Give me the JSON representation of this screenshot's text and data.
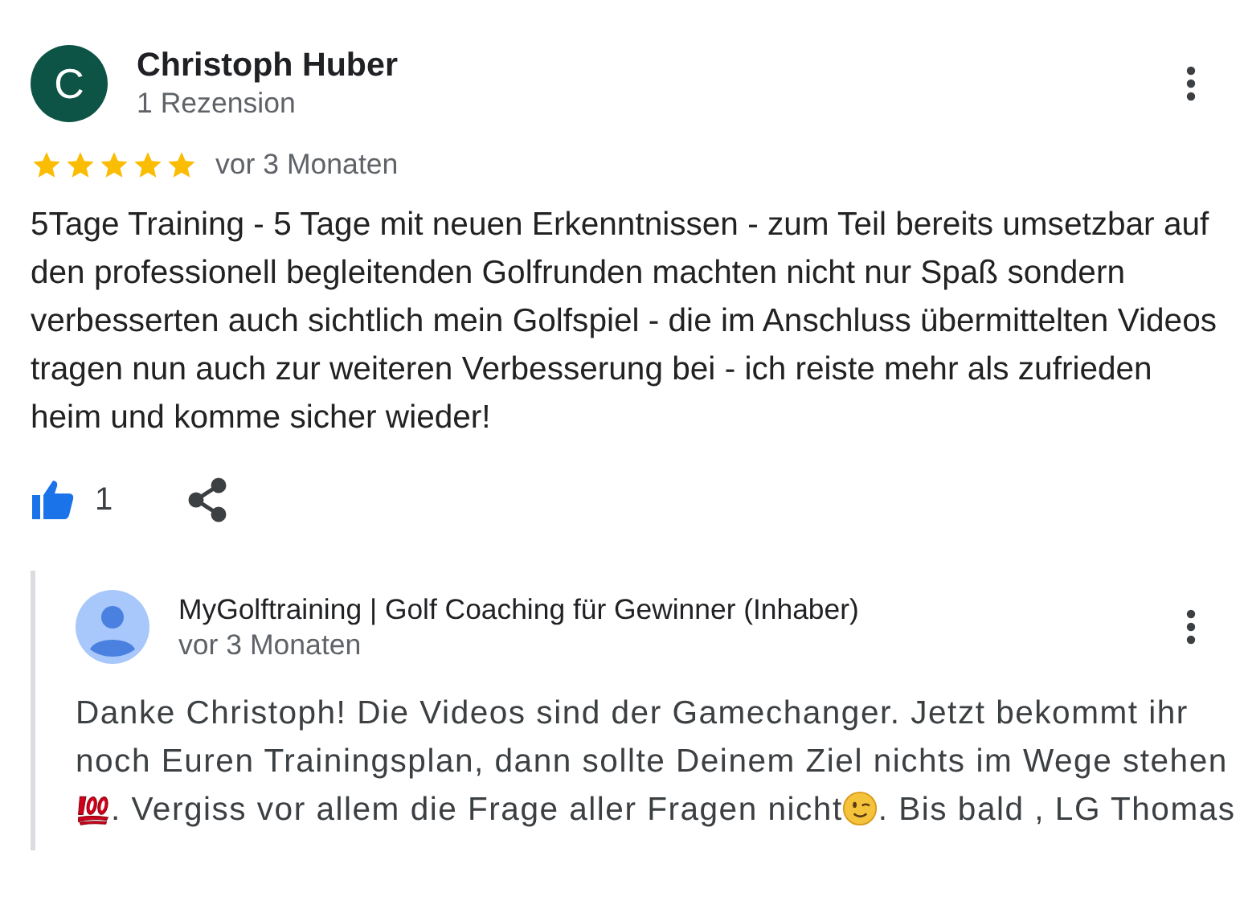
{
  "review": {
    "avatar_letter": "C",
    "author": "Christoph Huber",
    "subtitle": "1 Rezension",
    "stars": 5,
    "time": "vor 3 Monaten",
    "text": "5Tage Training - 5 Tage mit neuen Erkenntnissen - zum Teil bereits umsetzbar auf den professionell begleitenden Golfrunden machten nicht nur Spaß sondern verbesserten auch sichtlich mein Golfspiel - die im Anschluss übermittelten Videos tragen nun auch zur weiteren Verbesserung bei - ich reiste mehr als zufrieden heim und komme sicher wieder!",
    "liked": true,
    "like_count": "1"
  },
  "reply": {
    "author": "MyGolftraining | Golf Coaching für Gewinner (Inhaber)",
    "time": "vor 3 Monaten",
    "lines": [
      [
        {
          "kind": "text",
          "text": "Danke Christoph! Die Videos sind der Gamechanger. Jetzt bekommt ihr"
        }
      ],
      [
        {
          "kind": "text",
          "text": "noch Euren Trainingsplan, dann sollte Deinem Ziel nichts im Wege stehen"
        }
      ],
      [
        {
          "kind": "hundred"
        },
        {
          "kind": "text",
          "text": ". Vergiss vor allem die Frage aller Fragen nicht"
        },
        {
          "kind": "wink"
        },
        {
          "kind": "text",
          "text": ". Bis bald , LG Thomas"
        }
      ]
    ]
  }
}
